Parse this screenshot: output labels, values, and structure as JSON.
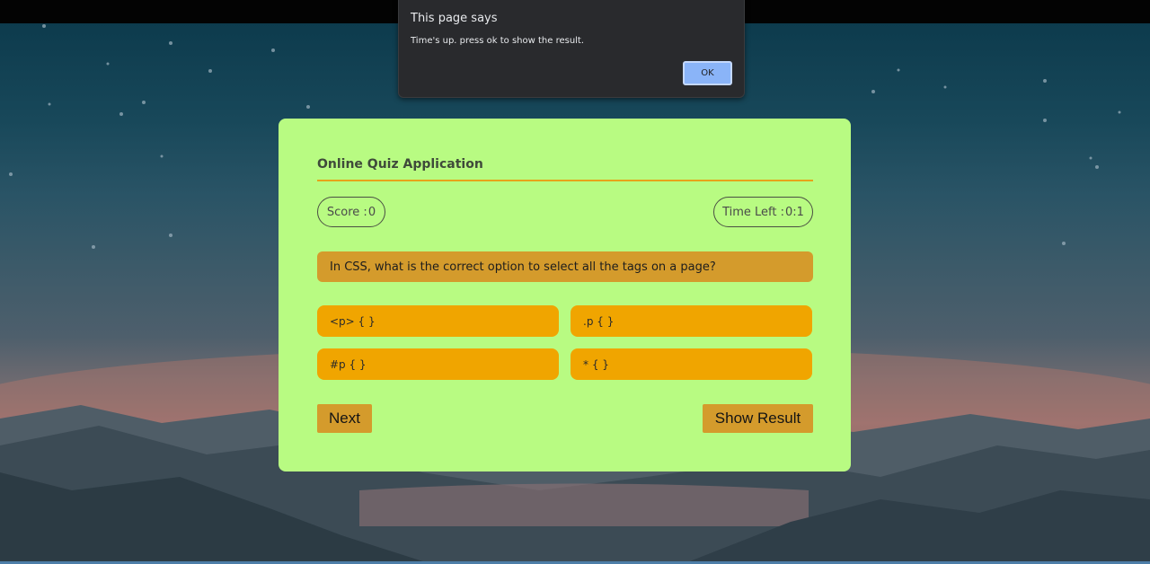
{
  "dialog": {
    "title": "This page says",
    "message": "Time's up. press ok to show the result.",
    "ok_label": "OK"
  },
  "quiz": {
    "title": "Online Quiz Application",
    "score_label": "Score :",
    "score_value": "0",
    "time_label": "Time Left :",
    "time_value": "0:1",
    "question": "In CSS, what is the correct option to select all the tags on a page?",
    "options": [
      "<p> { }",
      ".p { }",
      "#p { }",
      "* { }"
    ],
    "next_label": "Next",
    "show_result_label": "Show Result"
  },
  "colors": {
    "card_bg": "#b8fb82",
    "accent": "#f0a500",
    "question_bg": "#d49b2c",
    "dialog_bg": "#292a2d",
    "ok_button": "#8ab4f8"
  }
}
